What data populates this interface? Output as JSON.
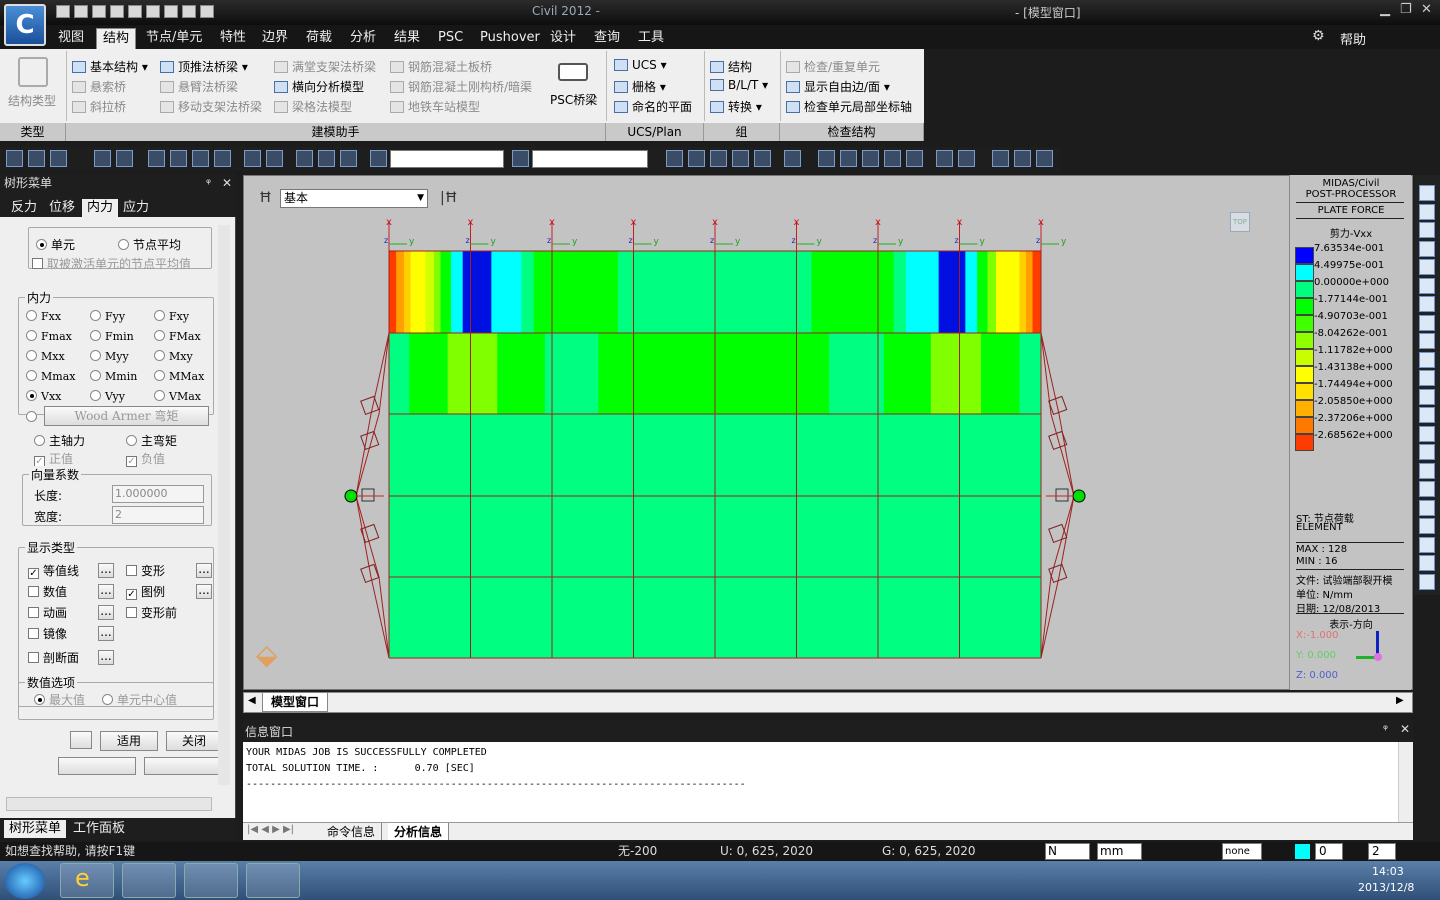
{
  "window": {
    "title_left": "Civil 2012 -",
    "title_right": "- [模型窗口]",
    "app_logo": "C"
  },
  "menu": {
    "tabs": [
      "视图",
      "结构",
      "节点/单元",
      "特性",
      "边界",
      "荷载",
      "分析",
      "结果",
      "PSC",
      "Pushover",
      "设计",
      "查询",
      "工具"
    ],
    "active": 1,
    "help": "帮助"
  },
  "ribbon": {
    "type_group": {
      "button": "结构类型",
      "label": "类型"
    },
    "wizard_group": {
      "label": "建模助手",
      "items": [
        {
          "text": "基本结构 ▾",
          "enabled": true
        },
        {
          "text": "悬索桥",
          "enabled": false
        },
        {
          "text": "斜拉桥",
          "enabled": false
        },
        {
          "text": "顶推法桥梁 ▾",
          "enabled": true
        },
        {
          "text": "悬臂法桥梁",
          "enabled": false
        },
        {
          "text": "移动支架法桥梁",
          "enabled": false
        },
        {
          "text": "满堂支架法桥梁",
          "enabled": false
        },
        {
          "text": "横向分析模型",
          "enabled": true
        },
        {
          "text": "梁格法模型",
          "enabled": false
        },
        {
          "text": "钢筋混凝土板桥",
          "enabled": false
        },
        {
          "text": "钢筋混凝土刚构桥/暗渠",
          "enabled": false
        },
        {
          "text": "地铁车站模型",
          "enabled": false
        }
      ],
      "psc": "PSC桥梁"
    },
    "ucs_group": {
      "label": "UCS/Plan",
      "items": [
        "UCS ▾",
        "栅格 ▾",
        "命名的平面"
      ]
    },
    "group_group": {
      "label": "组",
      "items": [
        "结构",
        "B/L/T ▾",
        "转换 ▾"
      ]
    },
    "check_group": {
      "label": "检查结构",
      "items": [
        {
          "text": "检查/重复单元",
          "enabled": false
        },
        {
          "text": "显示自由边/面 ▾",
          "enabled": true
        },
        {
          "text": "检查单元局部坐标轴",
          "enabled": true
        }
      ]
    }
  },
  "left_panel": {
    "title": "树形菜单",
    "tabs": [
      "反力",
      "位移",
      "内力",
      "应力"
    ],
    "active_tab": 2,
    "mode": {
      "options": [
        "单元",
        "节点平均"
      ],
      "selected": 0,
      "inactive_avg": "取被激活单元的节点平均值"
    },
    "force": {
      "label": "内力",
      "options": [
        "Fxx",
        "Fyy",
        "Fxy",
        "Fmax",
        "Fmin",
        "FMax",
        "Mxx",
        "Myy",
        "Mxy",
        "Mmax",
        "Mmin",
        "MMax",
        "Vxx",
        "Vyy",
        "VMax"
      ],
      "selected": "Vxx",
      "wood_armer": "Wood Armer 弯矩"
    },
    "principal": {
      "axial": "主轴力",
      "moment": "主弯矩",
      "positive": "正值",
      "negative": "负值"
    },
    "vector": {
      "label": "向量系数",
      "length_label": "长度:",
      "length_value": "1.000000",
      "width_label": "宽度:",
      "width_value": "2"
    },
    "display": {
      "label": "显示类型",
      "items": [
        {
          "text": "等值线",
          "checked": true
        },
        {
          "text": "数值",
          "checked": false
        },
        {
          "text": "动画",
          "checked": false
        },
        {
          "text": "镜像",
          "checked": false
        },
        {
          "text": "剖断面",
          "checked": false
        }
      ],
      "items2": [
        {
          "text": "变形",
          "checked": false
        },
        {
          "text": "图例",
          "checked": true
        },
        {
          "text": "变形前",
          "checked": false
        }
      ],
      "more": "..."
    },
    "value_opts": {
      "label": "数值选项",
      "max": "最大值",
      "center": "单元中心值"
    },
    "apply": "适用",
    "close": "关闭",
    "bottom_tabs": [
      "树形菜单",
      "工作面板"
    ]
  },
  "viewport": {
    "view_select": "基本",
    "tab": "模型窗口",
    "cube_label": "TOP"
  },
  "legend": {
    "header1": "MIDAS/Civil",
    "header2": "POST-PROCESSOR",
    "header3": "PLATE FORCE",
    "component": "剪力-Vxx",
    "values": [
      "7.63534e-001",
      "4.49975e-001",
      "0.00000e+000",
      "-1.77144e-001",
      "-4.90703e-001",
      "-8.04262e-001",
      "-1.11782e+000",
      "-1.43138e+000",
      "-1.74494e+000",
      "-2.05850e+000",
      "-2.37206e+000",
      "-2.68562e+000"
    ],
    "colors": [
      "#0000ff",
      "#00ffff",
      "#00ff80",
      "#00ff00",
      "#40ff00",
      "#90ff00",
      "#c8ff00",
      "#ffff00",
      "#ffe000",
      "#ffb000",
      "#ff7800",
      "#ff3c00"
    ],
    "st": "ST: 节点荷载",
    "element": "ELEMENT",
    "max": "MAX : 128",
    "min": "MIN : 16",
    "file": "文件: 试验端部裂开模",
    "unit": "单位: N/mm",
    "date": "日期: 12/08/2013",
    "direction": "表示-方向",
    "x": "X:-1.000",
    "y": "Y: 0.000",
    "z": "Z: 0.000"
  },
  "info": {
    "title": "信息窗口",
    "lines": [
      "YOUR MIDAS JOB IS SUCCESSFULLY COMPLETED",
      "TOTAL SOLUTION TIME. :      0.70 [SEC]",
      "-----------------------------------------------------------------------------------"
    ],
    "tabs": [
      "命令信息",
      "分析信息"
    ]
  },
  "status": {
    "help": "如想查找帮助, 请按F1键",
    "none": "无-200",
    "u": "U: 0, 625, 2020",
    "g": "G: 0, 625, 2020",
    "force_unit": "N",
    "length_unit": "mm",
    "sel": "none",
    "page1": "0",
    "page2": "2"
  },
  "taskbar": {
    "time": "14:03",
    "date": "2013/12/8"
  }
}
